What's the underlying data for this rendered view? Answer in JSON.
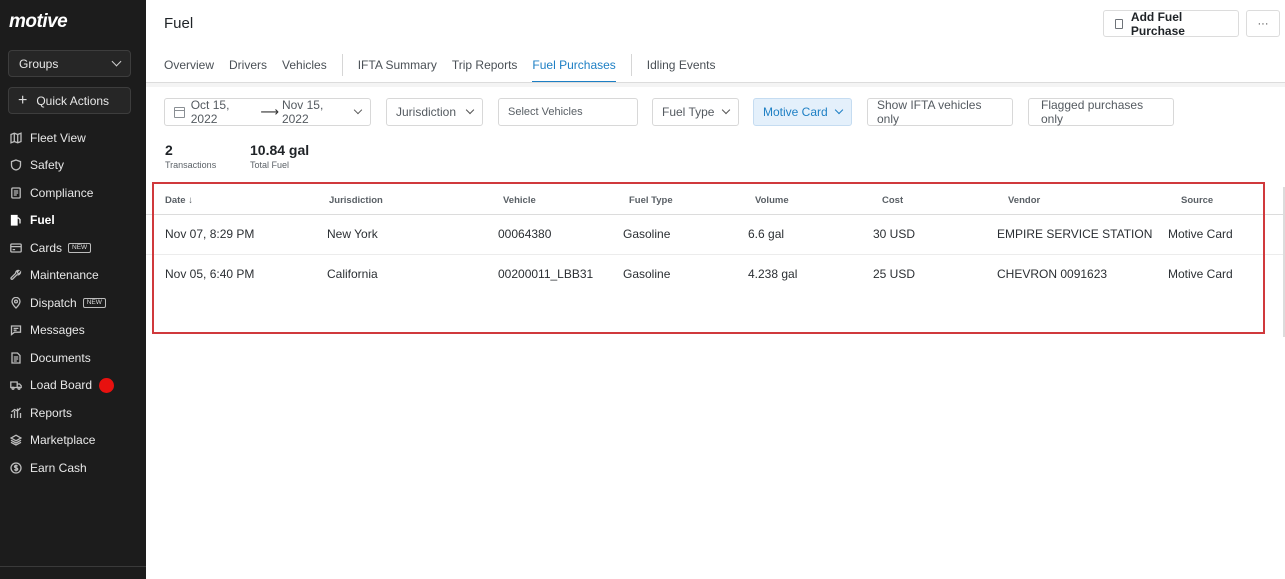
{
  "sidebar": {
    "logo": "motive",
    "groups_label": "Groups",
    "quick_actions_label": "Quick Actions",
    "items": [
      {
        "label": "Fleet View",
        "icon": "map-icon"
      },
      {
        "label": "Safety",
        "icon": "shield-icon"
      },
      {
        "label": "Compliance",
        "icon": "document-icon"
      },
      {
        "label": "Fuel",
        "icon": "fuel-pump-icon",
        "active": true
      },
      {
        "label": "Cards",
        "icon": "card-icon",
        "badge": "NEW"
      },
      {
        "label": "Maintenance",
        "icon": "wrench-icon"
      },
      {
        "label": "Dispatch",
        "icon": "pin-icon",
        "badge": "NEW"
      },
      {
        "label": "Messages",
        "icon": "message-icon"
      },
      {
        "label": "Documents",
        "icon": "file-icon"
      },
      {
        "label": "Load Board",
        "icon": "truck-icon",
        "dot_color": "#e8110f"
      },
      {
        "label": "Reports",
        "icon": "bar-chart-icon"
      },
      {
        "label": "Marketplace",
        "icon": "layers-icon"
      },
      {
        "label": "Earn Cash",
        "icon": "dollar-circle-icon"
      }
    ]
  },
  "header": {
    "title": "Fuel",
    "add_button": "Add Fuel Purchase",
    "more_button": "···"
  },
  "tabs": {
    "items": [
      "Overview",
      "Drivers",
      "Vehicles",
      "IFTA Summary",
      "Trip Reports",
      "Fuel Purchases",
      "Idling Events"
    ],
    "active": "Fuel Purchases"
  },
  "filters": {
    "date_from": "Oct 15, 2022",
    "date_to": "Nov 15, 2022",
    "jurisdiction": "Jurisdiction",
    "vehicles_placeholder": "Select Vehicles",
    "fuel_type": "Fuel Type",
    "card": "Motive Card",
    "ifta_only": "Show IFTA vehicles only",
    "flagged_only": "Flagged purchases only"
  },
  "summary": {
    "transactions_value": "2",
    "transactions_label": "Transactions",
    "fuel_value": "10.84 gal",
    "fuel_label": "Total Fuel"
  },
  "table": {
    "headers": [
      "Date ↓",
      "Jurisdiction",
      "Vehicle",
      "Fuel Type",
      "Volume",
      "Cost",
      "Vendor",
      "Source"
    ],
    "rows": [
      [
        "Nov 07, 8:29 PM",
        "New York",
        "00064380",
        "Gasoline",
        "6.6 gal",
        "30 USD",
        "EMPIRE SERVICE STATION",
        "Motive Card"
      ],
      [
        "Nov 05, 6:40 PM",
        "California",
        "00200011_LBB31",
        "Gasoline",
        "4.238 gal",
        "25 USD",
        "CHEVRON 0091623",
        "Motive Card"
      ]
    ]
  },
  "colors": {
    "accent": "#1d7fc4",
    "sidebar_bg": "#1c1c1c",
    "highlight_border": "#d0393c"
  }
}
